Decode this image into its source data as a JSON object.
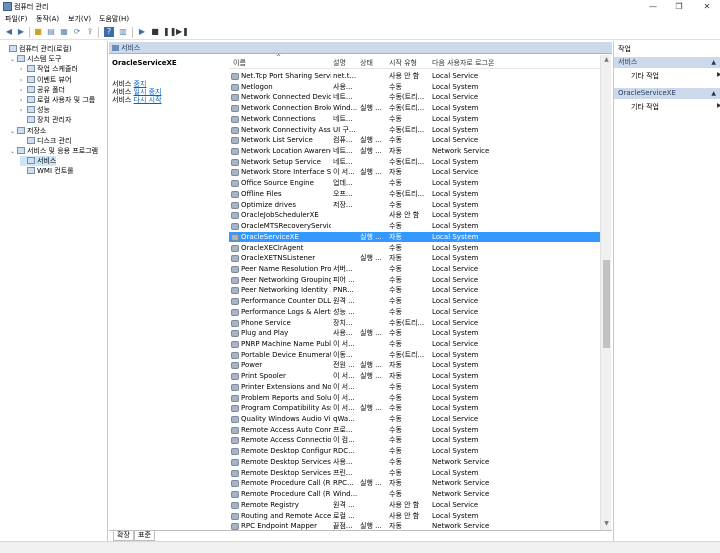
{
  "window": {
    "title": "컴퓨터 관리",
    "minimize": "—",
    "maximize": "❐",
    "close": "✕"
  },
  "menu": [
    "파일(F)",
    "동작(A)",
    "보기(V)",
    "도움말(H)"
  ],
  "tree": [
    {
      "label": "컴퓨터 관리(로컬)",
      "level": 0,
      "exp": ""
    },
    {
      "label": "시스템 도구",
      "level": 1,
      "exp": "⌄"
    },
    {
      "label": "작업 스케줄러",
      "level": 2,
      "exp": "›"
    },
    {
      "label": "이벤트 뷰어",
      "level": 2,
      "exp": "›"
    },
    {
      "label": "공유 폴더",
      "level": 2,
      "exp": "›"
    },
    {
      "label": "로컬 사용자 및 그룹",
      "level": 2,
      "exp": "›"
    },
    {
      "label": "성능",
      "level": 2,
      "exp": "›"
    },
    {
      "label": "장치 관리자",
      "level": 2,
      "exp": ""
    },
    {
      "label": "저장소",
      "level": 1,
      "exp": "⌄"
    },
    {
      "label": "디스크 관리",
      "level": 2,
      "exp": ""
    },
    {
      "label": "서비스 및 응용 프로그램",
      "level": 1,
      "exp": "⌄"
    },
    {
      "label": "서비스",
      "level": 2,
      "exp": "",
      "selected": true
    },
    {
      "label": "WMI 컨트롤",
      "level": 2,
      "exp": ""
    }
  ],
  "middle": {
    "header": "서비스",
    "selected_service": "OracleServiceXE",
    "links": [
      {
        "prefix": "서비스 ",
        "link": "중지"
      },
      {
        "prefix": "서비스 ",
        "link": "일시 중지"
      },
      {
        "prefix": "서비스 ",
        "link": "다시 시작"
      }
    ]
  },
  "columns": [
    "이름",
    "설명",
    "상태",
    "시작 유형",
    "다음 사용자로 로그온"
  ],
  "sort_indicator": "^",
  "services": [
    {
      "name": "Net.Tcp Port Sharing Service",
      "desc": "net.t...",
      "status": "",
      "startup": "사용 안 함",
      "logon": "Local Service"
    },
    {
      "name": "Netlogon",
      "desc": "사용...",
      "status": "",
      "startup": "수동",
      "logon": "Local System"
    },
    {
      "name": "Network Connected Device...",
      "desc": "네트...",
      "status": "",
      "startup": "수동(트리...",
      "logon": "Local Service"
    },
    {
      "name": "Network Connection Broker",
      "desc": "Wind...",
      "status": "실행 ...",
      "startup": "수동(트리...",
      "logon": "Local System"
    },
    {
      "name": "Network Connections",
      "desc": "네트...",
      "status": "",
      "startup": "수동",
      "logon": "Local System"
    },
    {
      "name": "Network Connectivity Assis...",
      "desc": "UI 구...",
      "status": "",
      "startup": "수동(트리...",
      "logon": "Local System"
    },
    {
      "name": "Network List Service",
      "desc": "컴퓨...",
      "status": "실행 ...",
      "startup": "수동",
      "logon": "Local Service"
    },
    {
      "name": "Network Location Awareness",
      "desc": "네트...",
      "status": "실행 ...",
      "startup": "자동",
      "logon": "Network Service"
    },
    {
      "name": "Network Setup Service",
      "desc": "네트...",
      "status": "",
      "startup": "수동(트리...",
      "logon": "Local System"
    },
    {
      "name": "Network Store Interface Se...",
      "desc": "이 서...",
      "status": "실행 ...",
      "startup": "자동",
      "logon": "Local Service"
    },
    {
      "name": "Office Source Engine",
      "desc": "업데...",
      "status": "",
      "startup": "수동",
      "logon": "Local System"
    },
    {
      "name": "Offline Files",
      "desc": "오프...",
      "status": "",
      "startup": "수동(트리...",
      "logon": "Local System"
    },
    {
      "name": "Optimize drives",
      "desc": "저장...",
      "status": "",
      "startup": "수동",
      "logon": "Local System"
    },
    {
      "name": "OracleJobSchedulerXE",
      "desc": "",
      "status": "",
      "startup": "사용 안 함",
      "logon": "Local System"
    },
    {
      "name": "OracleMTSRecoveryService",
      "desc": "",
      "status": "",
      "startup": "수동",
      "logon": "Local System"
    },
    {
      "name": "OracleServiceXE",
      "desc": "",
      "status": "실행 ...",
      "startup": "자동",
      "logon": "Local System",
      "selected": true
    },
    {
      "name": "OracleXEClrAgent",
      "desc": "",
      "status": "",
      "startup": "수동",
      "logon": "Local System"
    },
    {
      "name": "OracleXETNSListener",
      "desc": "",
      "status": "실행 ...",
      "startup": "자동",
      "logon": "Local System"
    },
    {
      "name": "Peer Name Resolution Prot...",
      "desc": "서버...",
      "status": "",
      "startup": "수동",
      "logon": "Local Service"
    },
    {
      "name": "Peer Networking Grouping",
      "desc": "피어 ...",
      "status": "",
      "startup": "수동",
      "logon": "Local Service"
    },
    {
      "name": "Peer Networking Identity ...",
      "desc": "PNR...",
      "status": "",
      "startup": "수동",
      "logon": "Local Service"
    },
    {
      "name": "Performance Counter DLL ...",
      "desc": "원격 ...",
      "status": "",
      "startup": "수동",
      "logon": "Local Service"
    },
    {
      "name": "Performance Logs & Alerts",
      "desc": "성능 ...",
      "status": "",
      "startup": "수동",
      "logon": "Local Service"
    },
    {
      "name": "Phone Service",
      "desc": "장치...",
      "status": "",
      "startup": "수동(트리...",
      "logon": "Local Service"
    },
    {
      "name": "Plug and Play",
      "desc": "사용...",
      "status": "실행 ...",
      "startup": "수동",
      "logon": "Local System"
    },
    {
      "name": "PNRP Machine Name Publi...",
      "desc": "이 서...",
      "status": "",
      "startup": "수동",
      "logon": "Local Service"
    },
    {
      "name": "Portable Device Enumerato...",
      "desc": "이동...",
      "status": "",
      "startup": "수동(트리...",
      "logon": "Local System"
    },
    {
      "name": "Power",
      "desc": "전원 ...",
      "status": "실행 ...",
      "startup": "자동",
      "logon": "Local System"
    },
    {
      "name": "Print Spooler",
      "desc": "이 서...",
      "status": "실행 ...",
      "startup": "자동",
      "logon": "Local System"
    },
    {
      "name": "Printer Extensions and Noti...",
      "desc": "이 서...",
      "status": "",
      "startup": "수동",
      "logon": "Local System"
    },
    {
      "name": "Problem Reports and Solut...",
      "desc": "이 서...",
      "status": "",
      "startup": "수동",
      "logon": "Local System"
    },
    {
      "name": "Program Compatibility Assi...",
      "desc": "이 서...",
      "status": "실행 ...",
      "startup": "수동",
      "logon": "Local System"
    },
    {
      "name": "Quality Windows Audio Vi...",
      "desc": "qWa...",
      "status": "",
      "startup": "수동",
      "logon": "Local Service"
    },
    {
      "name": "Remote Access Auto Conn...",
      "desc": "프로...",
      "status": "",
      "startup": "수동",
      "logon": "Local System"
    },
    {
      "name": "Remote Access Connection...",
      "desc": "이 컴...",
      "status": "",
      "startup": "수동",
      "logon": "Local System"
    },
    {
      "name": "Remote Desktop Configura...",
      "desc": "RDC...",
      "status": "",
      "startup": "수동",
      "logon": "Local System"
    },
    {
      "name": "Remote Desktop Services",
      "desc": "사용...",
      "status": "",
      "startup": "수동",
      "logon": "Network Service"
    },
    {
      "name": "Remote Desktop Services ...",
      "desc": "프린...",
      "status": "",
      "startup": "수동",
      "logon": "Local System"
    },
    {
      "name": "Remote Procedure Call (RP...",
      "desc": "RPC...",
      "status": "실행 ...",
      "startup": "자동",
      "logon": "Network Service"
    },
    {
      "name": "Remote Procedure Call (RP...",
      "desc": "Wind...",
      "status": "",
      "startup": "수동",
      "logon": "Network Service"
    },
    {
      "name": "Remote Registry",
      "desc": "원격 ...",
      "status": "",
      "startup": "사용 안 함",
      "logon": "Local Service"
    },
    {
      "name": "Routing and Remote Access",
      "desc": "로컬 ...",
      "status": "",
      "startup": "사용 안 함",
      "logon": "Local System"
    },
    {
      "name": "RPC Endpoint Mapper",
      "desc": "끝점...",
      "status": "실행 ...",
      "startup": "자동",
      "logon": "Network Service"
    }
  ],
  "tabs": [
    "확장",
    "표준"
  ],
  "actions": {
    "title": "작업",
    "sections": [
      {
        "header": "서비스",
        "item": "기타 작업"
      },
      {
        "header": "OracleServiceXE",
        "item": "기타 작업"
      }
    ]
  },
  "colors": {
    "selection": "#3399ff",
    "pane_header": "#ccd9ea",
    "tree_selection": "#cde6f7",
    "link": "#0066cc"
  }
}
